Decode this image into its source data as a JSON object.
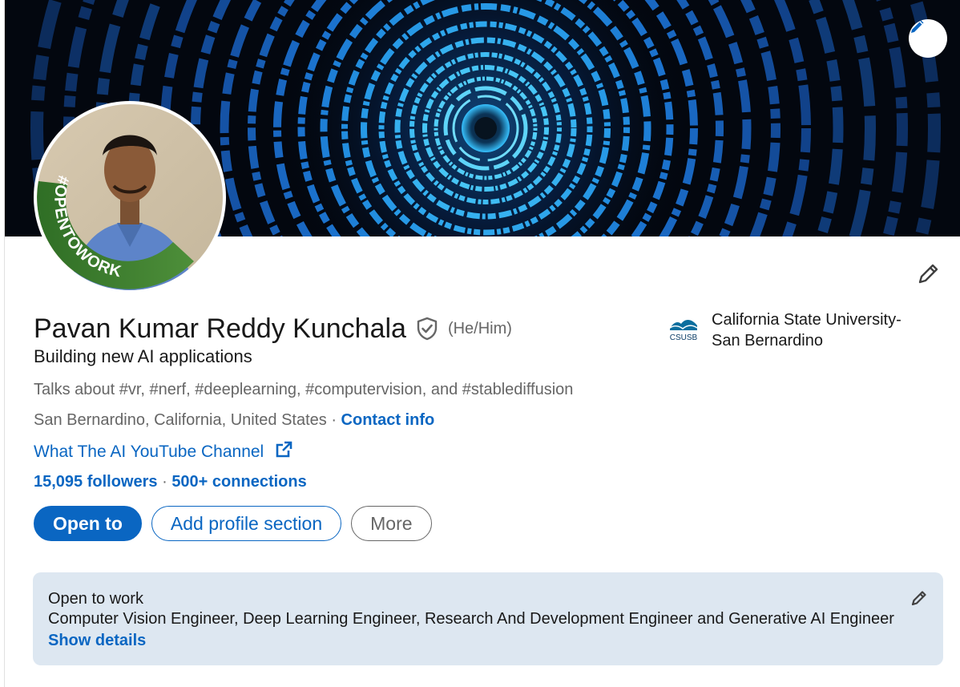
{
  "profile": {
    "name": "Pavan Kumar Reddy Kunchala",
    "pronouns": "(He/Him)",
    "headline": "Building new AI applications",
    "talks_about": "Talks about #vr, #nerf, #deeplearning, #computervision, and #stablediffusion",
    "location": "San Bernardino, California, United States",
    "separator": " · ",
    "contact_info_label": "Contact info",
    "website_label": "What The AI YouTube Channel",
    "followers": "15,095 followers",
    "connections": "500+ connections",
    "avatar_badge_text": "#OPENTOWORK"
  },
  "education": {
    "logo_text": "CSUSB",
    "name_line1": "California State University-",
    "name_line2": "San Bernardino"
  },
  "actions": {
    "open_to": "Open to",
    "add_section": "Add profile section",
    "more": "More"
  },
  "open_to_work": {
    "title": "Open to work",
    "roles": "Computer Vision Engineer, Deep Learning Engineer, Research And Development Engineer and Generative AI Engineer",
    "show_details": "Show details"
  },
  "colors": {
    "accent": "#0a66c2",
    "open_to_work_green": "#3a7f2e",
    "card_tint": "#dde7f1",
    "banner_glow": "#2fa8ff"
  },
  "icons": {
    "banner_edit": "pencil-icon",
    "profile_edit": "pencil-icon",
    "verification": "shield-check-icon",
    "external_link": "external-link-icon",
    "open_to_work_edit": "pencil-icon"
  }
}
